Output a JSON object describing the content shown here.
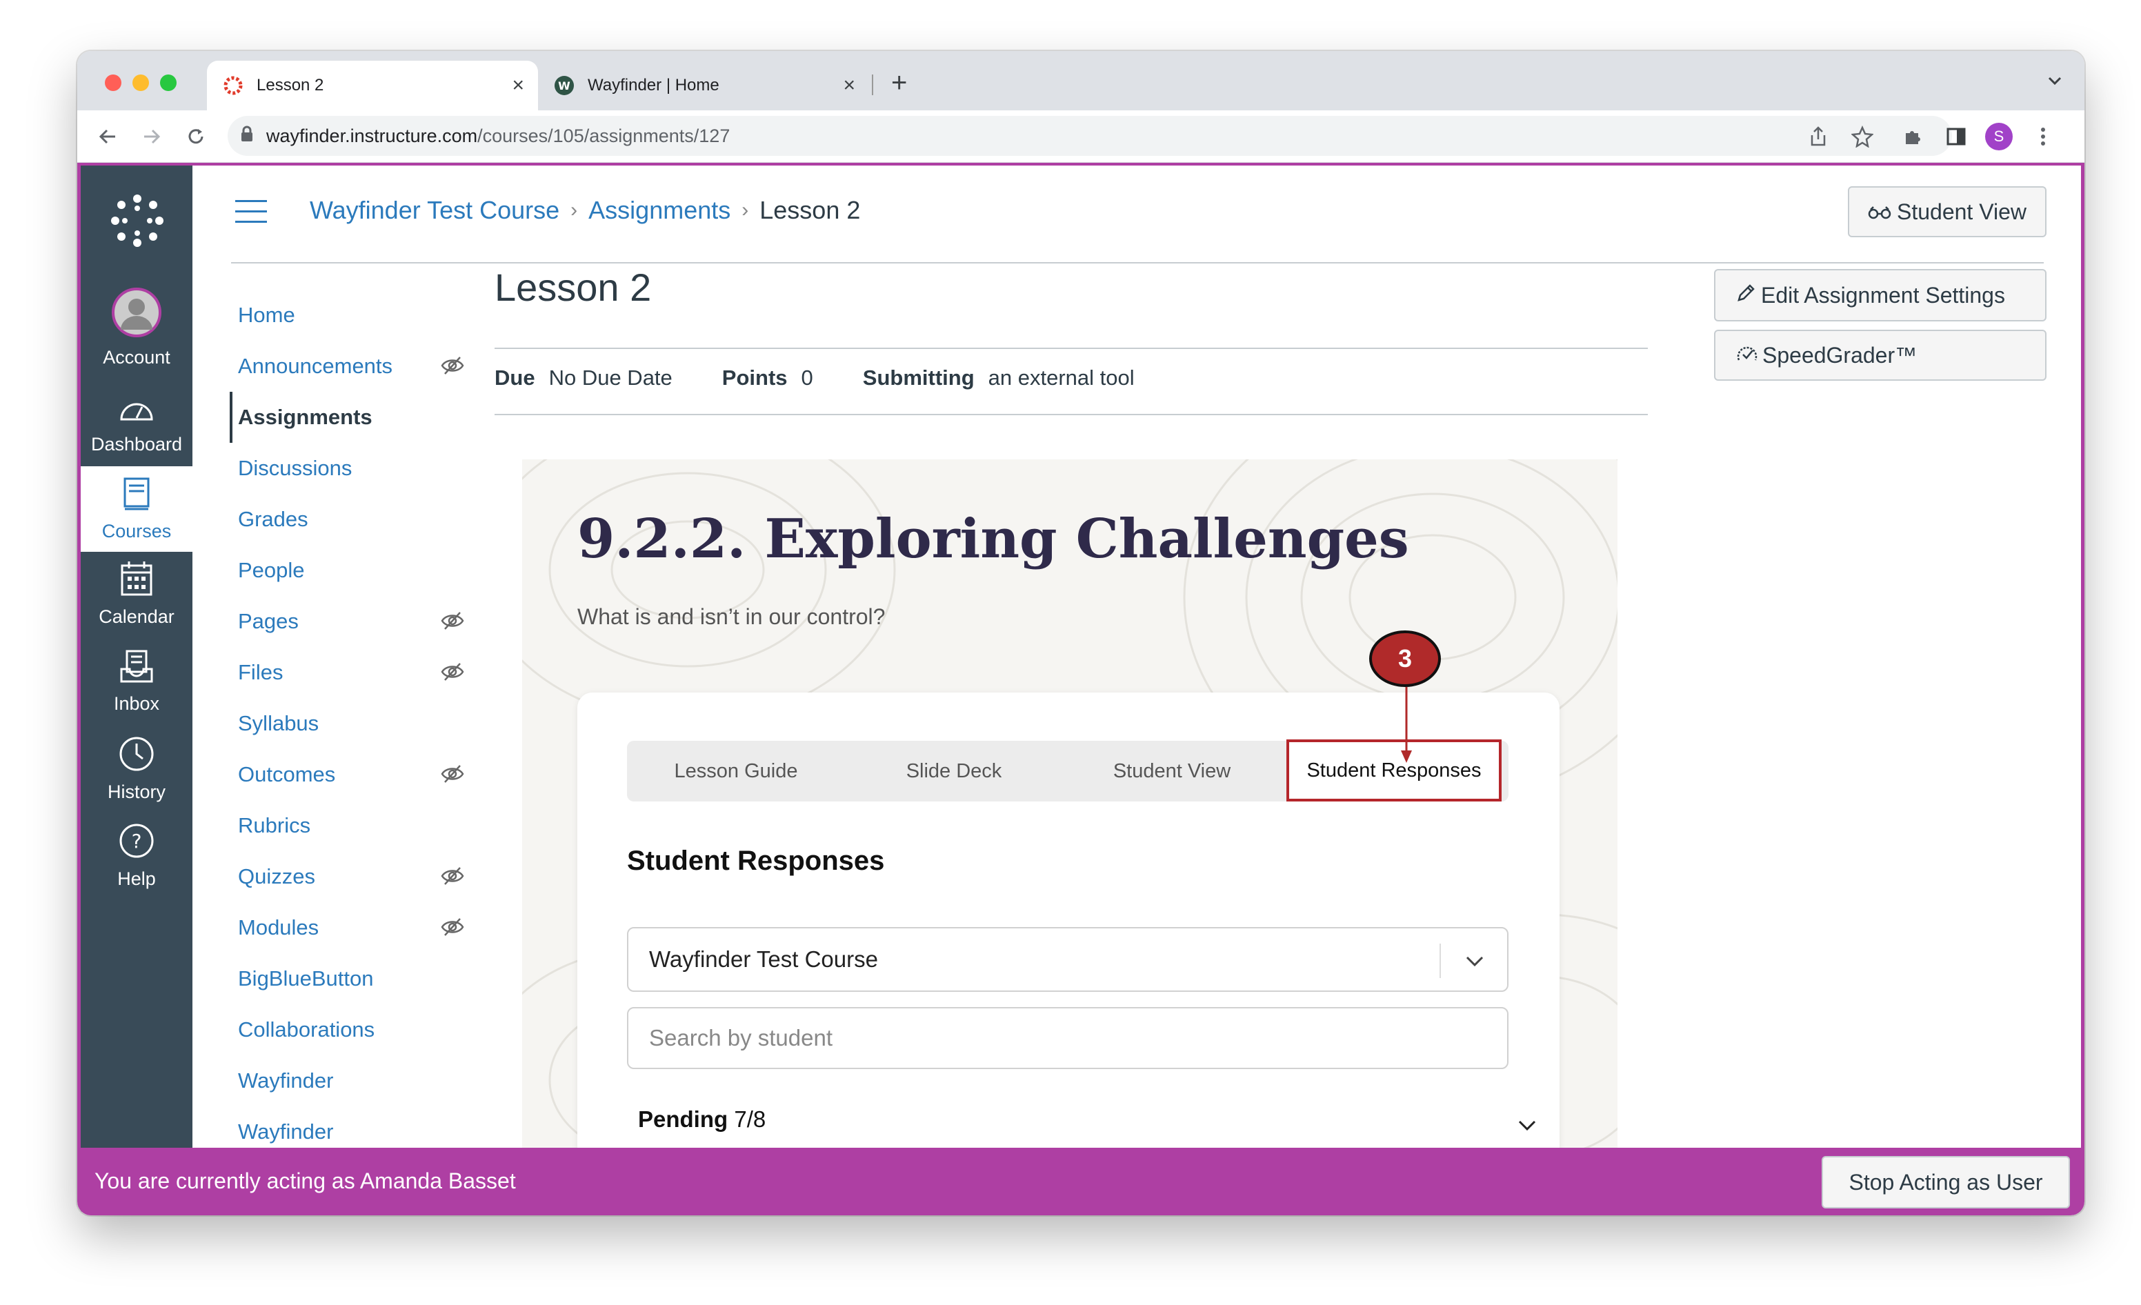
{
  "browser": {
    "tabs": [
      {
        "title": "Lesson 2",
        "active": true
      },
      {
        "title": "Wayfinder | Home",
        "active": false
      }
    ],
    "url_host": "wayfinder.instructure.com",
    "url_path": "/courses/105/assignments/127",
    "profile_initial": "S"
  },
  "global_nav": [
    {
      "label": "Account",
      "icon": "avatar-icon"
    },
    {
      "label": "Dashboard",
      "icon": "dashboard-icon"
    },
    {
      "label": "Courses",
      "icon": "courses-icon",
      "active": true
    },
    {
      "label": "Calendar",
      "icon": "calendar-icon"
    },
    {
      "label": "Inbox",
      "icon": "inbox-icon"
    },
    {
      "label": "History",
      "icon": "history-icon"
    },
    {
      "label": "Help",
      "icon": "help-icon"
    }
  ],
  "breadcrumb": {
    "course": "Wayfinder Test Course",
    "section": "Assignments",
    "current": "Lesson 2"
  },
  "student_view_button": "Student View",
  "course_nav": [
    {
      "label": "Home"
    },
    {
      "label": "Announcements",
      "hidden": true
    },
    {
      "label": "Assignments",
      "active": true
    },
    {
      "label": "Discussions"
    },
    {
      "label": "Grades"
    },
    {
      "label": "People"
    },
    {
      "label": "Pages",
      "hidden": true
    },
    {
      "label": "Files",
      "hidden": true
    },
    {
      "label": "Syllabus"
    },
    {
      "label": "Outcomes",
      "hidden": true
    },
    {
      "label": "Rubrics"
    },
    {
      "label": "Quizzes",
      "hidden": true
    },
    {
      "label": "Modules",
      "hidden": true
    },
    {
      "label": "BigBlueButton"
    },
    {
      "label": "Collaborations"
    },
    {
      "label": "Wayfinder"
    },
    {
      "label": "Wayfinder"
    }
  ],
  "assignment": {
    "title": "Lesson 2",
    "due_label": "Due",
    "due_value": "No Due Date",
    "points_label": "Points",
    "points_value": "0",
    "submitting_label": "Submitting",
    "submitting_value": "an external tool"
  },
  "side_buttons": {
    "edit": "Edit Assignment Settings",
    "speedgrader": "SpeedGrader™"
  },
  "lesson": {
    "heading": "9.2.2. Exploring Challenges",
    "subtitle": "What is and isn’t in our control?",
    "tabs": [
      "Lesson Guide",
      "Slide Deck",
      "Student View",
      "Student Responses"
    ],
    "selected_tab": "Student Responses",
    "section_title": "Student Responses",
    "course_select": "Wayfinder Test Course",
    "search_placeholder": "Search by student",
    "pending_label": "Pending",
    "pending_count": "7/8"
  },
  "callout_number": "3",
  "acting_banner": {
    "text": "You are currently acting as Amanda Basset",
    "button": "Stop Acting as User"
  },
  "colors": {
    "accent": "#ae3fa3",
    "link": "#2b7abc",
    "nav_bg": "#394b58",
    "callout": "#b02a2a"
  }
}
